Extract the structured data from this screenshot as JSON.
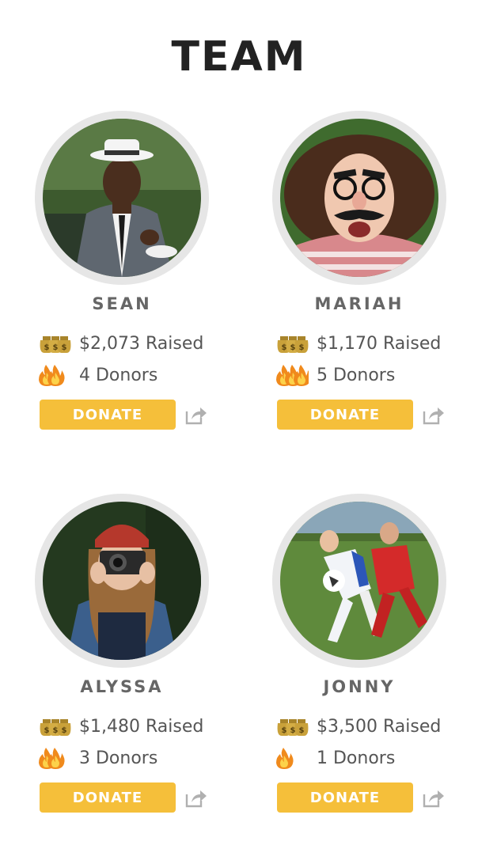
{
  "page": {
    "title": "TEAM"
  },
  "colors": {
    "button": "#f5bf3a",
    "ring": "#e6e6e6",
    "share_icon": "#b0b0b0"
  },
  "members": [
    {
      "name": "SEAN",
      "raised": "$2,073 Raised",
      "donors": "4 Donors",
      "donate_label": "DONATE",
      "fire_count": 2,
      "photo": "man-in-hat-suit-photo"
    },
    {
      "name": "MARIAH",
      "raised": "$1,170 Raised",
      "donors": "5 Donors",
      "donate_label": "DONATE",
      "fire_count": 3,
      "photo": "woman-with-groucho-glasses-photo"
    },
    {
      "name": "ALYSSA",
      "raised": "$1,480 Raised",
      "donors": "3 Donors",
      "donate_label": "DONATE",
      "fire_count": 2,
      "photo": "woman-with-camera-photo"
    },
    {
      "name": "JONNY",
      "raised": "$3,500 Raised",
      "donors": "1 Donors",
      "donate_label": "DONATE",
      "fire_count": 1,
      "photo": "soccer-players-photo"
    }
  ]
}
